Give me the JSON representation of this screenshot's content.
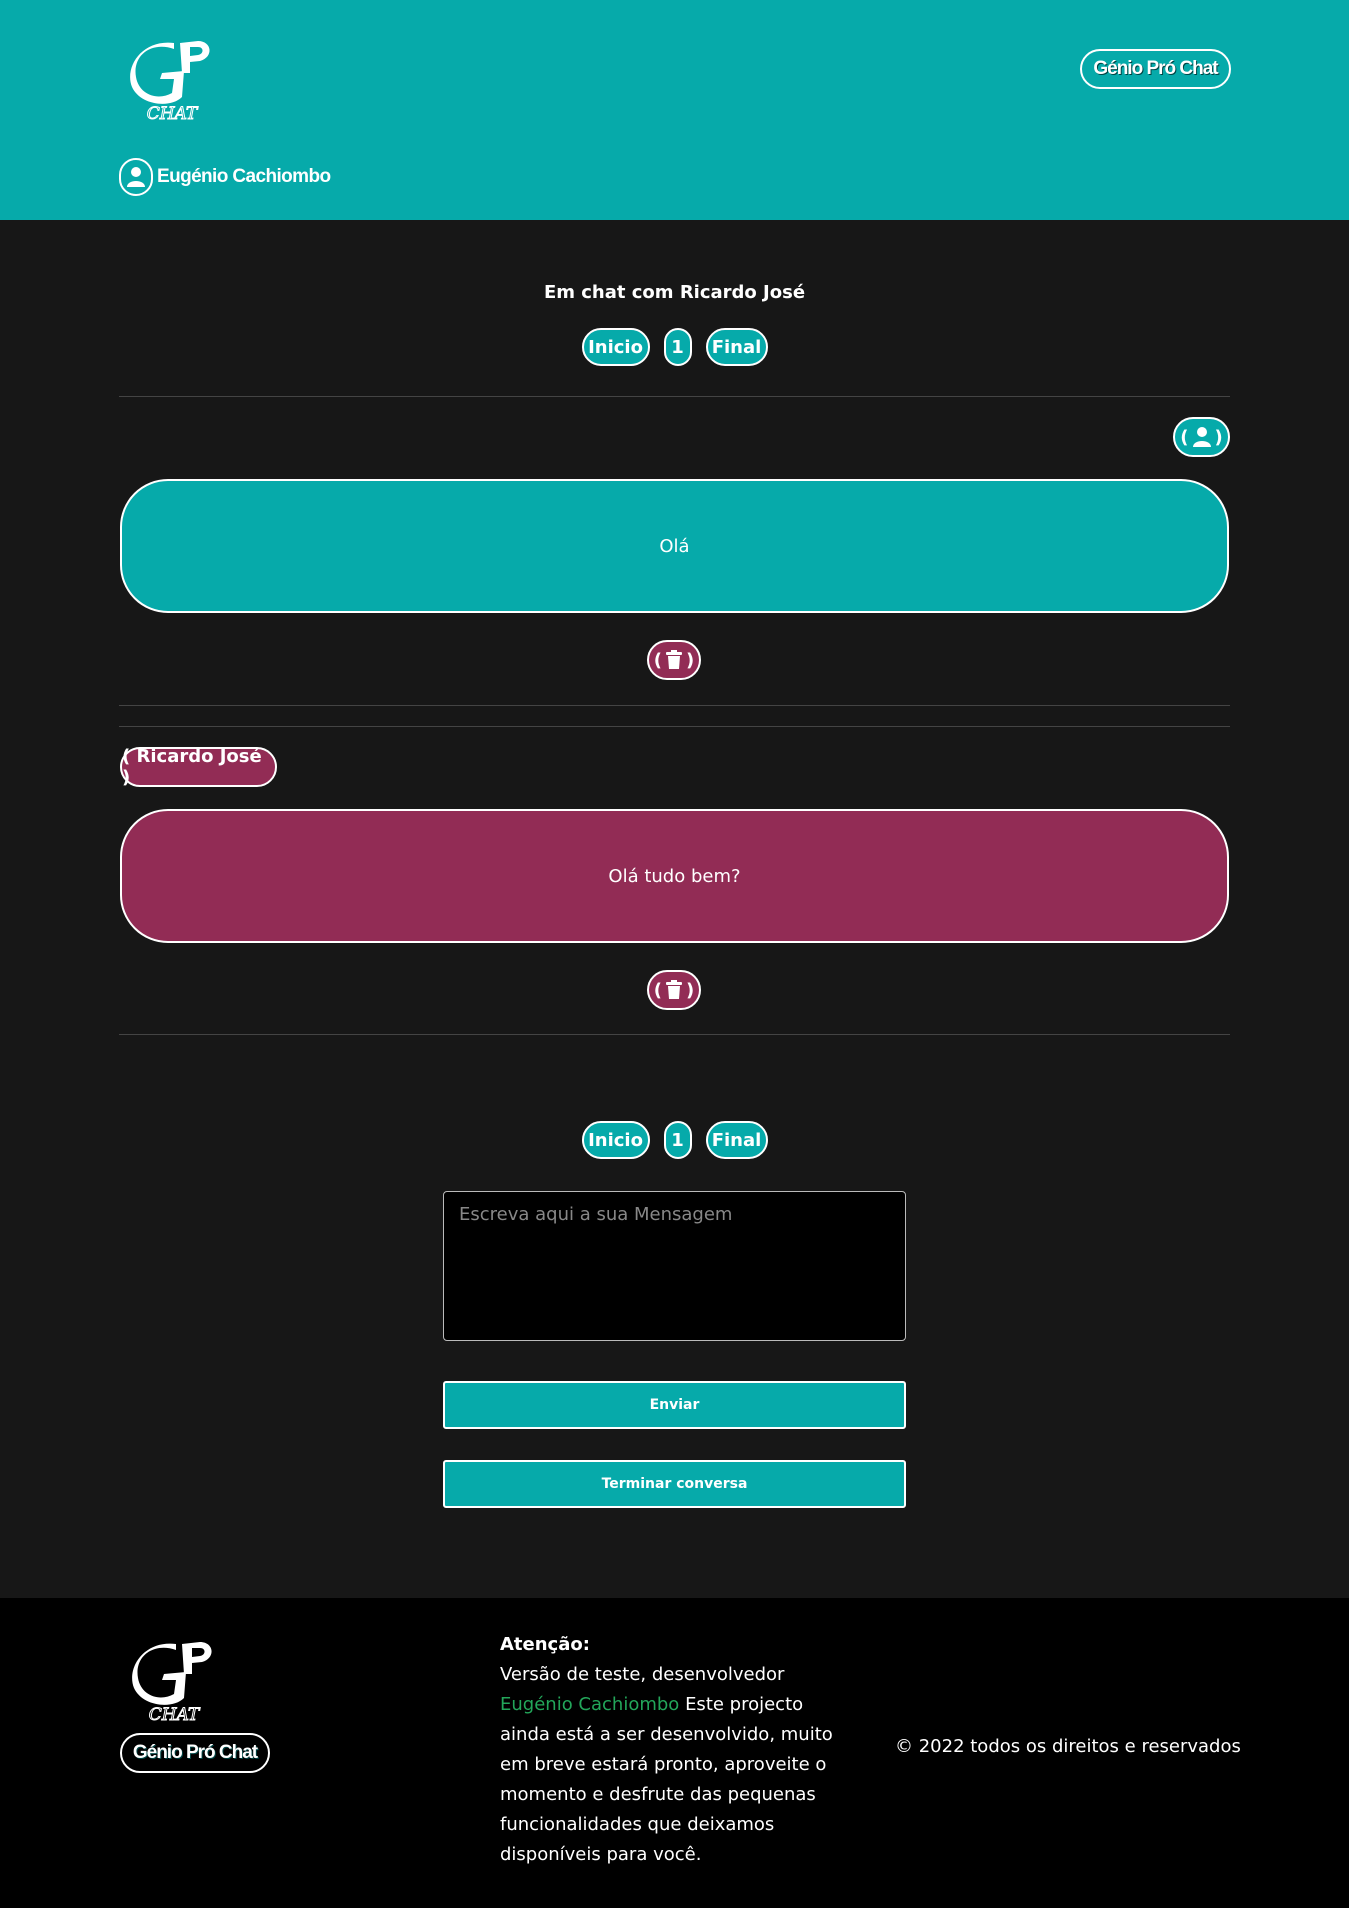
{
  "header": {
    "logo_text": "GP CHAT",
    "brand_button": "Génio Pró Chat",
    "user_name": "Eugénio Cachiombo"
  },
  "chat": {
    "title": "Em chat com Ricardo José",
    "pager": {
      "start": "Inicio",
      "page": "1",
      "end": "Final"
    },
    "messages": [
      {
        "sender_label": "",
        "text": "Olá"
      },
      {
        "sender_label": "( Ricardo José )",
        "text": "Olá tudo bem?"
      }
    ],
    "delete_label": "( )"
  },
  "composer": {
    "placeholder": "Escreva aqui a sua Mensagem",
    "send": "Enviar",
    "end_chat": "Terminar conversa"
  },
  "footer": {
    "brand_button": "Génio Pró Chat",
    "notice_title": "Atenção:",
    "notice_lead": "Versão de teste, desenvolvedor",
    "developer": "Eugénio Cachiombo",
    "notice_body": "Este projecto ainda está a ser desenvolvido, muito em breve estará pronto, aproveite o momento e desfrute das pequenas funcionalidades que deixamos disponíveis para você.",
    "copyright": "© 2022 todos os direitos e reservados"
  },
  "colors": {
    "teal": "#06aaaa",
    "wine": "#922c55",
    "dark": "#171717",
    "link_green": "#23a65a"
  },
  "icons": [
    "logo-icon",
    "user-icon",
    "trash-icon"
  ]
}
